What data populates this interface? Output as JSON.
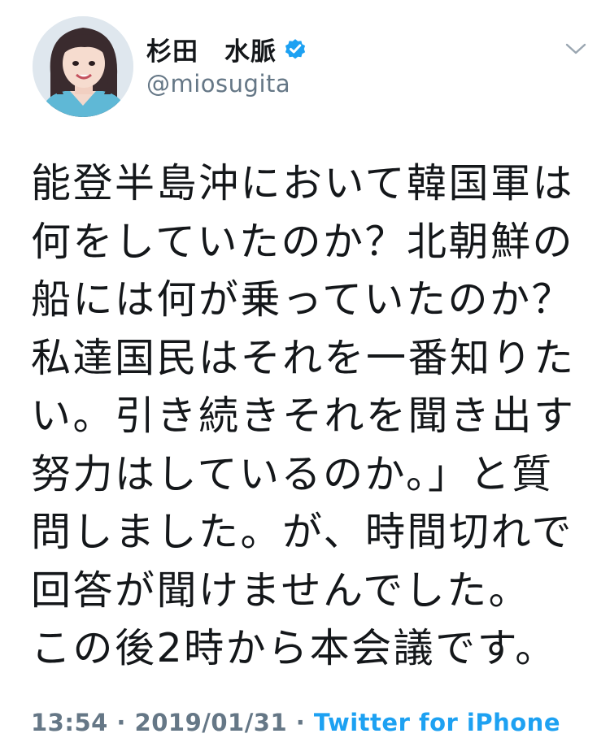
{
  "author": {
    "display_name": "杉田　水脈",
    "handle": "@miosugita",
    "verified": true
  },
  "tweet": {
    "lines": [
      "能登半島沖において韓国軍は",
      "何をしていたのか？北朝鮮の",
      "船には何が乗っていたのか？",
      "私達国民はそれを一番知りた",
      "い。引き続きそれを聞き出す",
      "努力はしているのか。」と質",
      "問しました。が、時間切れで",
      "回答が聞けませんでした。",
      "この後2時から本会議です。"
    ]
  },
  "meta": {
    "time": "13:54",
    "date": "2019/01/31",
    "separator": " · ",
    "source": "Twitter for iPhone"
  },
  "icons": {
    "verified": "verified-badge-icon",
    "menu": "chevron-down-icon"
  },
  "colors": {
    "text": "#14171a",
    "secondary": "#657786",
    "accent": "#1da1f2"
  }
}
